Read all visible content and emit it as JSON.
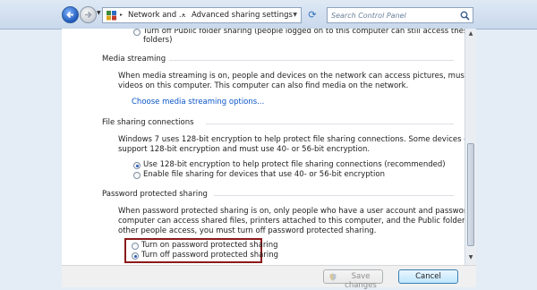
{
  "address_bar": {
    "breadcrumbs": [
      "Network and ...",
      "Advanced sharing settings"
    ],
    "search_placeholder": "Search Control Panel"
  },
  "public_folder": {
    "off_option": "Turn off Public folder sharing (people logged on to this computer can still access these",
    "off_option_cont": "folders)"
  },
  "media_streaming": {
    "title": "Media streaming",
    "description_line1": "When media streaming is on, people and devices on the network can access pictures, music, and",
    "description_line2": "videos on this computer. This computer can also find media on the network.",
    "link": "Choose media streaming options..."
  },
  "file_sharing": {
    "title": "File sharing connections",
    "description_line1": "Windows 7 uses 128-bit encryption to help protect file sharing connections. Some devices don't",
    "description_line2": "support 128-bit encryption and must use 40- or 56-bit encryption.",
    "options": [
      {
        "label": "Use 128-bit encryption to help protect file sharing connections (recommended)",
        "selected": true
      },
      {
        "label": "Enable file sharing for devices that use 40- or 56-bit encryption",
        "selected": false
      }
    ]
  },
  "password_sharing": {
    "title": "Password protected sharing",
    "description_line1": "When password protected sharing is on, only people who have a user account and password on this",
    "description_line2": "computer can access shared files, printers attached to this computer, and the Public folders. To give",
    "description_line3": "other people access, you must turn off password protected sharing.",
    "options": [
      {
        "label": "Turn on password protected sharing",
        "selected": false
      },
      {
        "label": "Turn off password protected sharing",
        "selected": true
      }
    ]
  },
  "footer": {
    "save_label": "Save changes",
    "cancel_label": "Cancel"
  }
}
